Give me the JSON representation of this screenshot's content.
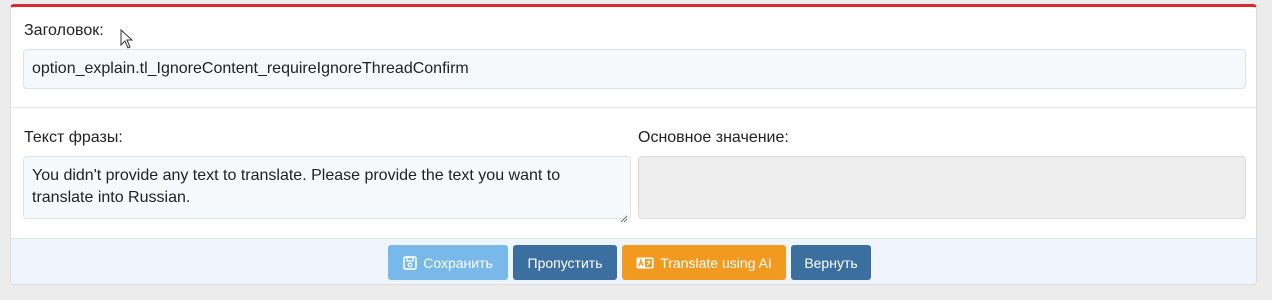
{
  "title_section": {
    "label": "Заголовок:",
    "value": "option_explain.tl_IgnoreContent_requireIgnoreThreadConfirm"
  },
  "phrase": {
    "label": "Текст фразы:",
    "value": "You didn't provide any text to translate. Please provide the text you want to translate into Russian."
  },
  "main_value": {
    "label": "Основное значение:",
    "value": ""
  },
  "buttons": {
    "save": "Сохранить",
    "skip": "Пропустить",
    "translate_ai": "Translate using AI",
    "revert": "Вернуть"
  },
  "colors": {
    "accent_top_border": "#e0282e",
    "save": "#79b9e9",
    "skip": "#3b6f9f",
    "translate_ai": "#f29a1f",
    "revert": "#3b6f9f"
  },
  "icons": {
    "save": "floppy-disk-icon",
    "translate_ai": "translate-icon",
    "pointer": "mouse-cursor-icon",
    "resize": "resize-grip-icon"
  }
}
